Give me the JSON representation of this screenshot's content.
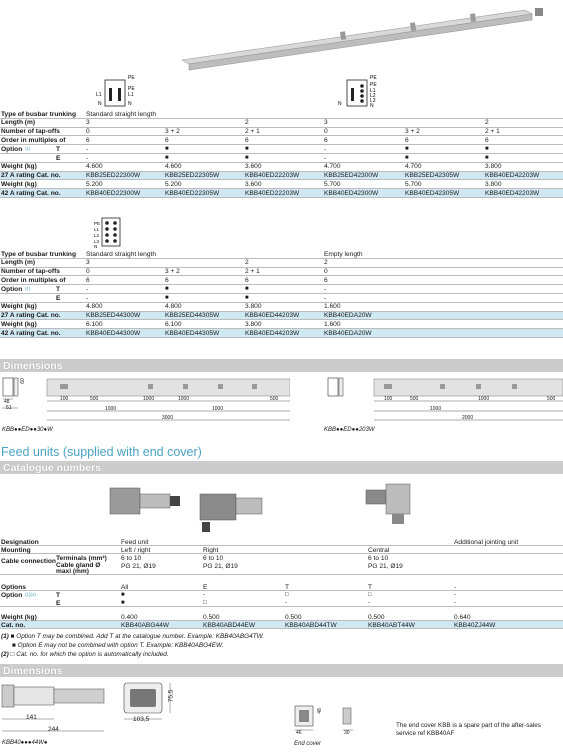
{
  "table1": {
    "header_label": "Type of busbar trunking",
    "header_value": "Standard straight length",
    "rows": [
      {
        "label": "Length (m)",
        "cells": [
          "3",
          "",
          "2",
          "3",
          "",
          "2"
        ]
      },
      {
        "label": "Number of tap-offs",
        "cells": [
          "0",
          "3 + 2",
          "2 + 1",
          "0",
          "3 + 2",
          "2 + 1"
        ]
      },
      {
        "label": "Order in multiples of",
        "cells": [
          "6",
          "6",
          "6",
          "6",
          "6",
          "6"
        ]
      },
      {
        "label": "Option",
        "sup": "(1)",
        "sub": "T",
        "cells": [
          "-",
          "■",
          "■",
          "-",
          "■",
          "■"
        ]
      },
      {
        "label": "",
        "sub": "E",
        "cells": [
          "-",
          "■",
          "■",
          "-",
          "■",
          "■"
        ]
      },
      {
        "label": "Weight (kg)",
        "cells": [
          "4.600",
          "4.600",
          "3.600",
          "4.700",
          "4.700",
          "3.800"
        ]
      },
      {
        "label": "27 A rating Cat. no.",
        "hl": true,
        "cells": [
          "KBB25ED22300W",
          "KBB25ED22305W",
          "KBB40ED22203W",
          "KBB25ED42300W",
          "KBB25ED42305W",
          "KBB40ED42203W"
        ]
      },
      {
        "label": "Weight (kg)",
        "cells": [
          "5.200",
          "5.200",
          "3.600",
          "5.700",
          "5.700",
          "3.800"
        ]
      },
      {
        "label": "42 A rating Cat. no.",
        "hl": true,
        "cells": [
          "KBB40ED22300W",
          "KBB40ED22305W",
          "KBB40ED22203W",
          "KBB40ED42300W",
          "KBB40ED42305W",
          "KBB40ED42203W"
        ]
      }
    ]
  },
  "table2": {
    "header_label": "Type of busbar trunking",
    "header_value": "Standard straight length",
    "header_value2": "Empty length",
    "rows": [
      {
        "label": "Length (m)",
        "cells": [
          "3",
          "",
          "2",
          "2"
        ]
      },
      {
        "label": "Number of tap-offs",
        "cells": [
          "0",
          "3 + 2",
          "2 + 1",
          "0"
        ]
      },
      {
        "label": "Order in multiples of",
        "cells": [
          "6",
          "6",
          "6",
          "6"
        ]
      },
      {
        "label": "Option",
        "sup": "(1)",
        "sub": "T",
        "cells": [
          "-",
          "■",
          "■",
          "-"
        ]
      },
      {
        "label": "",
        "sub": "E",
        "cells": [
          "-",
          "■",
          "■",
          "-"
        ]
      },
      {
        "label": "Weight (kg)",
        "cells": [
          "4.800",
          "4.800",
          "3.800",
          "1.600"
        ]
      },
      {
        "label": "27 A rating Cat. no.",
        "hl": true,
        "cells": [
          "KBB25ED44300W",
          "KBB25ED44305W",
          "KBB40ED44203W",
          "KBB40EDA20W"
        ]
      },
      {
        "label": "Weight (kg)",
        "cells": [
          "6.100",
          "6.100",
          "3.800",
          "1.600"
        ]
      },
      {
        "label": "42 A rating Cat. no.",
        "hl": true,
        "cells": [
          "KBB40ED44300W",
          "KBB40ED44305W",
          "KBB40ED44203W",
          "KBB40EDA20W"
        ]
      }
    ]
  },
  "dimensions1": {
    "title": "Dimensions",
    "left_caption": "KBB●●ED●●30●W",
    "right_caption": "KBB●●ED●●203W",
    "left_dims": [
      "100",
      "500",
      "1000",
      "1000",
      "500",
      "1000",
      "1000",
      "3000"
    ],
    "right_dims": [
      "100",
      "500",
      "1000",
      "500",
      "1000",
      "2000"
    ],
    "side_dims": [
      "48",
      "51",
      "60"
    ]
  },
  "feed_units": {
    "title": "Feed units (supplied with end cover)",
    "catalogue_title": "Catalogue numbers",
    "designation_label": "Designation",
    "designation_value": "Feed unit",
    "designation_value2": "Additional jointing unit",
    "mounting_label": "Mounting",
    "mounting_values": [
      "Left / right",
      "Right",
      "Central"
    ],
    "cable_connection_label": "Cable connection",
    "terminals_label": "Terminals (mm²)",
    "terminals_values": [
      "6 to 10",
      "6 to 10",
      "6 to 10"
    ],
    "gland_label": "Cable gland Ø maxi (mm)",
    "gland_values": [
      "PG 21, Ø19",
      "PG 21, Ø19",
      "PG 21, Ø19"
    ],
    "options_label": "Options",
    "options_values": [
      "All",
      "E",
      "T",
      "T",
      "-"
    ],
    "option_label": "Option",
    "option_sup": "(1)(2)",
    "option_T": [
      "■",
      "-",
      "□",
      "□",
      "-"
    ],
    "option_E": [
      "■",
      "□",
      "-",
      "-",
      "-"
    ],
    "weight_label": "Weight (kg)",
    "weight_values": [
      "0.400",
      "0.500",
      "0.500",
      "0.500",
      "0.640"
    ],
    "cat_label": "Cat. no.",
    "cat_values": [
      "KBB40ABG44W",
      "KBB40ABD44EW",
      "KBB40ABD44TW",
      "KBB40ABT44W",
      "KBB40ZJ44W"
    ]
  },
  "notes": [
    {
      "marker": "(1)",
      "text": "■ Option T may be combined. Add T at the catalogue number. Example: KBB40ABG4TW."
    },
    {
      "marker": "",
      "text": "■ Option E may not be combined with option T. Example: KBB40ABG4EW."
    },
    {
      "marker": "(2)",
      "text": "□ Cat. no. for which the option is automatically included."
    }
  ],
  "dimensions2": {
    "title": "Dimensions",
    "left_caption": "KBB40●●●44W●",
    "dims": [
      "141",
      "244",
      "103,5",
      "75,5",
      "46",
      "48",
      "30"
    ],
    "end_cover_caption": "End cover",
    "end_cover_note": "The end cover KBB is a spare part of the after-sales service ref KBB40AF"
  },
  "labels": {
    "pe": "PE",
    "l1": "L1",
    "n": "N",
    "l2": "L2",
    "l3": "L3"
  }
}
